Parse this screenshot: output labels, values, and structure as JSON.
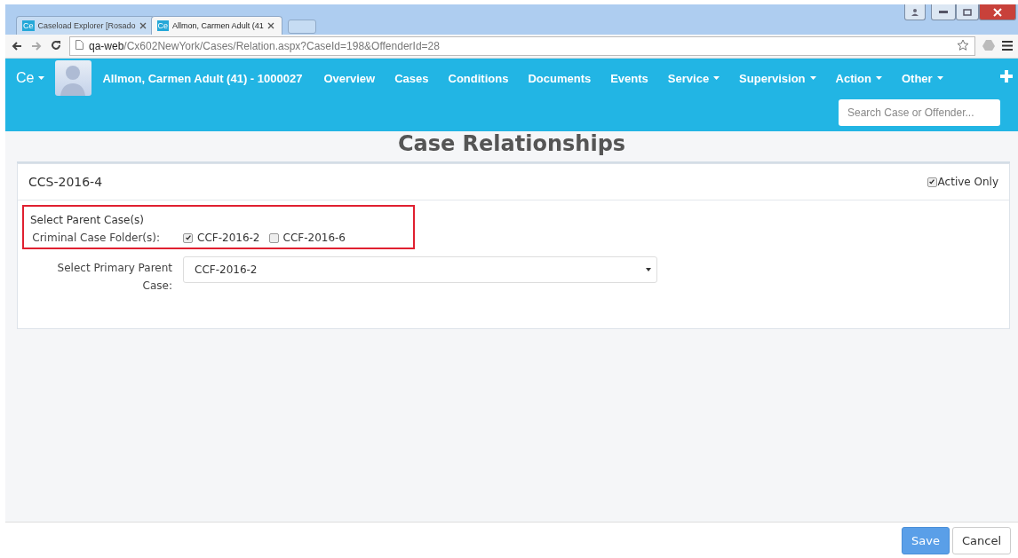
{
  "browser": {
    "tabs": [
      {
        "icon_text": "Ce",
        "title": "Caseload Explorer [Rosado",
        "selected": false
      },
      {
        "icon_text": "Ce",
        "title": "Allmon, Carmen Adult (41",
        "selected": true
      }
    ],
    "url_host": "qa-web",
    "url_path": "/Cx602NewYork/Cases/Relation.aspx?CaseId=198&OffenderId=28"
  },
  "nav": {
    "brand": "Ce",
    "person": "Allmon, Carmen Adult (41) - 1000027",
    "items": [
      {
        "label": "Overview",
        "dropdown": false
      },
      {
        "label": "Cases",
        "dropdown": false
      },
      {
        "label": "Conditions",
        "dropdown": false
      },
      {
        "label": "Documents",
        "dropdown": false
      },
      {
        "label": "Events",
        "dropdown": false
      },
      {
        "label": "Service",
        "dropdown": true
      },
      {
        "label": "Supervision",
        "dropdown": true
      },
      {
        "label": "Action",
        "dropdown": true
      },
      {
        "label": "Other",
        "dropdown": true
      }
    ],
    "search": {
      "placeholder": "Search Case or Offender..."
    }
  },
  "page": {
    "heading": "Case Relationships"
  },
  "panel": {
    "case": "CCS-2016-4",
    "active_only": {
      "label": "Active Only",
      "checked": true
    },
    "parent_section": {
      "title": "Select Parent Case(s)",
      "label": "Criminal Case Folder(s):",
      "highlighted": true,
      "options": [
        {
          "label": "CCF-2016-2",
          "checked": true
        },
        {
          "label": "CCF-2016-6",
          "checked": false
        }
      ]
    },
    "primary": {
      "label": "Select Primary Parent Case:",
      "value": "CCF-2016-2"
    }
  },
  "footer": {
    "buttons": [
      {
        "label": "Save",
        "kind": "primary"
      },
      {
        "label": "Cancel",
        "kind": "default"
      }
    ]
  }
}
